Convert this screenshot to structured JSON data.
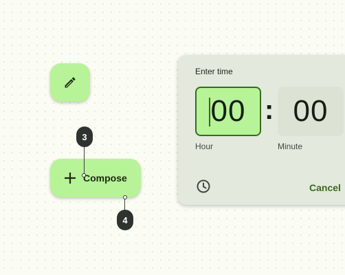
{
  "fab_edit": {
    "icon": "pencil-icon"
  },
  "fab_compose": {
    "icon": "plus-icon",
    "label": "Compose"
  },
  "callouts": [
    "3",
    "4"
  ],
  "dialog": {
    "title": "Enter time",
    "hour_value": "00",
    "hour_label": "Hour",
    "separator": ":",
    "minute_value": "00",
    "minute_label": "Minute",
    "mode_icon": "clock-icon",
    "cancel_label": "Cancel"
  },
  "colors": {
    "background": "#fbfcf3",
    "fab": "#b7f397",
    "primary": "#386a20",
    "dialog_surface": "#e3e9dc",
    "minute_surface": "#dce3d4",
    "callout": "#2f3330"
  }
}
